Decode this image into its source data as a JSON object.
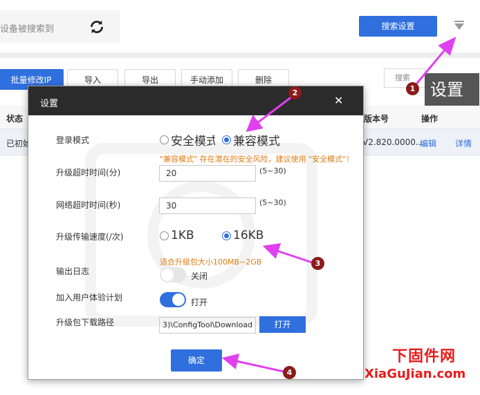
{
  "top": {
    "search_hint": "设备被搜索到",
    "search_settings_label": "搜索设置"
  },
  "toolbar": {
    "batch_modify_ip": "批量修改IP",
    "import": "导入",
    "export": "导出",
    "manual_add": "手动添加",
    "delete": "删除",
    "search_placeholder": "搜索"
  },
  "tooltip": {
    "settings": "设置"
  },
  "table": {
    "headers": {
      "status": "状态",
      "version": "版本号",
      "actions": "操作"
    },
    "row": {
      "status": "已初始",
      "version": "V2.820.0000...",
      "edit": "编辑",
      "details": "详情"
    }
  },
  "dialog": {
    "title": "设置",
    "login_mode": {
      "label": "登录模式",
      "options": [
        "安全模式",
        "兼容模式"
      ],
      "selected": "兼容模式",
      "warning": "\"兼容模式\" 存在潜在的安全风险，建议使用 \"安全模式\"！"
    },
    "upgrade_timeout": {
      "label": "升级超时时间(分)",
      "value": "20",
      "range": "(5~30)"
    },
    "network_timeout": {
      "label": "网络超时时间(秒)",
      "value": "30",
      "range": "(5~30)"
    },
    "transfer_speed": {
      "label": "升级传输速度(/次)",
      "options": [
        "1KB",
        "16KB"
      ],
      "selected": "16KB",
      "hint": "适合升级包大小100MB~2GB"
    },
    "output_log": {
      "label": "输出日志",
      "state": "关闭",
      "on": false
    },
    "user_experience": {
      "label": "加入用户体验计划",
      "state": "打开",
      "on": true
    },
    "download_path": {
      "label": "升级包下载路径",
      "value": "3)\\ConfigTool\\Download",
      "open_button": "打开"
    },
    "confirm_button": "确定"
  },
  "annotations": {
    "badges": [
      "1",
      "2",
      "3",
      "4"
    ],
    "arrow_color": "#e040f0",
    "badge_color": "#8b1b1b"
  },
  "watermark_logo": {
    "line1": "下固件网",
    "line2": "XiaGuJian.com",
    "color": "#e81b1b"
  },
  "colors": {
    "primary": "#2f6fde",
    "dialog_header": "#2b2b2b",
    "warning": "#e07b12"
  }
}
